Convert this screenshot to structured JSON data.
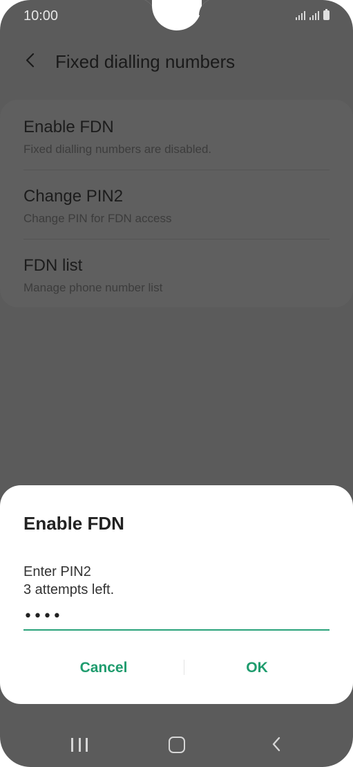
{
  "status_bar": {
    "time": "10:00",
    "icons": [
      "signal-icon",
      "signal-icon",
      "battery-icon"
    ]
  },
  "app_bar": {
    "back_icon": "chevron-left-icon",
    "title": "Fixed dialling numbers"
  },
  "settings": {
    "items": [
      {
        "title": "Enable FDN",
        "subtitle": "Fixed dialling numbers are disabled."
      },
      {
        "title": "Change PIN2",
        "subtitle": "Change PIN for FDN access"
      },
      {
        "title": "FDN list",
        "subtitle": "Manage phone number list"
      }
    ]
  },
  "dialog": {
    "title": "Enable FDN",
    "message_line1": "Enter PIN2",
    "message_line2": "3 attempts left.",
    "pin_value": "••••",
    "cancel_label": "Cancel",
    "ok_label": "OK",
    "accent_color": "#1f9c6e"
  },
  "nav_bar": {
    "icons": [
      "recents-icon",
      "home-icon",
      "back-icon"
    ]
  },
  "colors": {
    "scrim": "#5b5b5b",
    "dialog_background": "#ffffff",
    "accent": "#1f9c6e"
  }
}
